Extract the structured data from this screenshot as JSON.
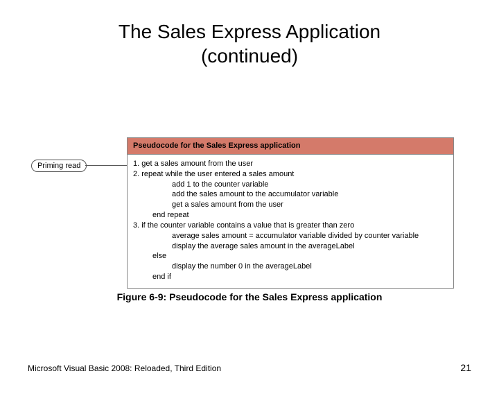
{
  "title_line1": "The Sales Express Application",
  "title_line2": "(continued)",
  "callout": "Priming read",
  "pseudocode_header": "Pseudocode for the Sales Express application",
  "pc": {
    "l1": "1. get a sales amount from the user",
    "l2": "2. repeat while the user entered a sales amount",
    "l3": "add 1 to the counter variable",
    "l4": "add the sales amount to the accumulator variable",
    "l5": "get a sales amount from the user",
    "l6": "end repeat",
    "l7": "3. if the counter variable contains a value that is greater than zero",
    "l8": "average sales amount = accumulator variable divided by counter variable",
    "l9": "display the average sales amount in the averageLabel",
    "l10": "else",
    "l11": "display the number 0 in the averageLabel",
    "l12": "end if"
  },
  "caption": "Figure 6-9: Pseudocode for the Sales Express application",
  "footer_left": "Microsoft Visual Basic 2008: Reloaded, Third Edition",
  "page_number": "21"
}
